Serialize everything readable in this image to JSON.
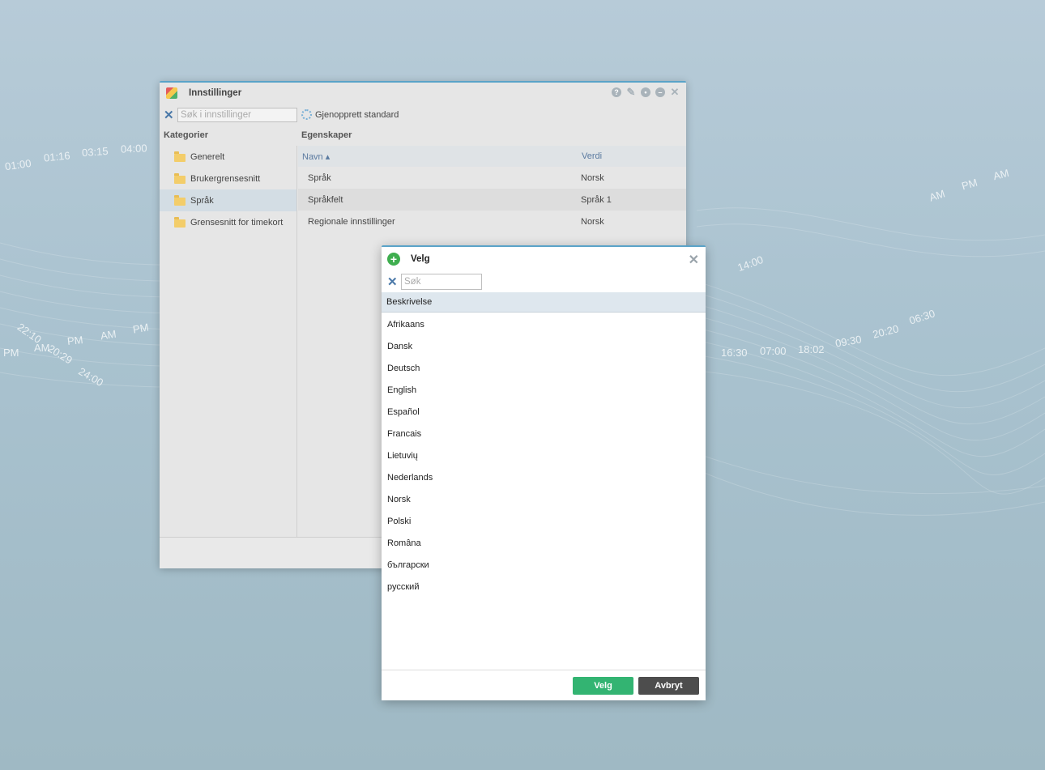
{
  "settings_window": {
    "title": "Innstillinger",
    "search_placeholder": "Søk i innstillinger",
    "restore_label": "Gjenopprett standard",
    "categories_header": "Kategorier",
    "properties_header": "Egenskaper",
    "categories": [
      {
        "label": "Generelt"
      },
      {
        "label": "Brukergrensesnitt"
      },
      {
        "label": "Språk"
      },
      {
        "label": "Grensesnitt for timekort"
      }
    ],
    "selected_category": "Språk",
    "columns": {
      "name": "Navn ▴",
      "value": "Verdi"
    },
    "rows": [
      {
        "name": "Språk",
        "value": "Norsk"
      },
      {
        "name": "Språkfelt",
        "value": "Språk 1"
      },
      {
        "name": "Regionale innstillinger",
        "value": "Norsk"
      }
    ]
  },
  "dialog": {
    "title": "Velg",
    "search_placeholder": "Søk",
    "list_header": "Beskrivelse",
    "languages": [
      "Afrikaans",
      "Dansk",
      "Deutsch",
      "English",
      "Español",
      "Francais",
      "Lietuvių",
      "Nederlands",
      "Norsk",
      "Polski",
      "Româna",
      "български",
      "русский"
    ],
    "ok_label": "Velg",
    "cancel_label": "Avbryt"
  },
  "wallpaper_clock_labels": [
    "01:00",
    "01:16",
    "03:15",
    "04:00",
    "PM",
    "AM",
    "PM",
    "AM",
    "PM",
    "AM",
    "PM",
    "AM",
    "14:00",
    "16:30",
    "07:00",
    "18:02",
    "09:30",
    "20:20",
    "22:10",
    "20:29",
    "24:00",
    "06:30"
  ],
  "colors": {
    "accent": "#5aa3c8",
    "ok_button": "#33b472",
    "cancel_button": "#4d4d4d",
    "selected_row": "#d3dde4"
  }
}
